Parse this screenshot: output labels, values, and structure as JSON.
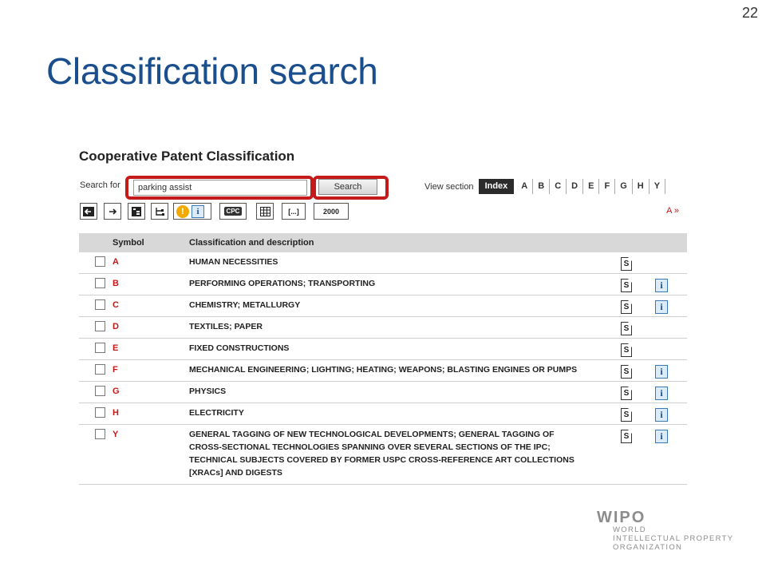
{
  "slide": {
    "page_number": "22",
    "title": "Classification search"
  },
  "app": {
    "title": "Cooperative Patent Classification",
    "search": {
      "label": "Search for",
      "value": "parking assist",
      "button_label": "Search"
    },
    "view_section": {
      "label": "View section",
      "index_label": "Index",
      "sections": [
        "A",
        "B",
        "C",
        "D",
        "E",
        "F",
        "G",
        "H",
        "Y"
      ]
    },
    "toolbar": {
      "cpc_label": "CPC",
      "bracket_label": "[...]",
      "year_label": "2000",
      "a_link": "A »"
    },
    "table": {
      "columns": [
        "Symbol",
        "Classification and description"
      ],
      "rows": [
        {
          "symbol": "A",
          "lines": [
            "HUMAN NECESSITIES"
          ],
          "has_s": true,
          "has_i": false
        },
        {
          "symbol": "B",
          "lines": [
            "PERFORMING OPERATIONS; TRANSPORTING"
          ],
          "has_s": true,
          "has_i": true
        },
        {
          "symbol": "C",
          "lines": [
            "CHEMISTRY; METALLURGY"
          ],
          "has_s": true,
          "has_i": true
        },
        {
          "symbol": "D",
          "lines": [
            "TEXTILES; PAPER"
          ],
          "has_s": true,
          "has_i": false
        },
        {
          "symbol": "E",
          "lines": [
            "FIXED CONSTRUCTIONS"
          ],
          "has_s": true,
          "has_i": false
        },
        {
          "symbol": "F",
          "lines": [
            "MECHANICAL ENGINEERING; LIGHTING; HEATING; WEAPONS; BLASTING ENGINES OR PUMPS"
          ],
          "has_s": true,
          "has_i": true
        },
        {
          "symbol": "G",
          "lines": [
            "PHYSICS"
          ],
          "has_s": true,
          "has_i": true
        },
        {
          "symbol": "H",
          "lines": [
            "ELECTRICITY"
          ],
          "has_s": true,
          "has_i": true
        },
        {
          "symbol": "Y",
          "lines": [
            "GENERAL TAGGING OF NEW TECHNOLOGICAL DEVELOPMENTS; GENERAL TAGGING OF",
            "CROSS-SECTIONAL TECHNOLOGIES SPANNING OVER SEVERAL SECTIONS OF THE IPC;",
            "TECHNICAL SUBJECTS COVERED BY FORMER USPC CROSS-REFERENCE ART COLLECTIONS",
            "[XRACs] AND DIGESTS"
          ],
          "has_s": true,
          "has_i": true
        }
      ],
      "s_icon_text": "S",
      "i_icon_text": "i"
    }
  },
  "logo": {
    "name": "WIPO",
    "lines": [
      "WORLD",
      "INTELLECTUAL PROPERTY",
      "ORGANIZATION"
    ]
  },
  "colors": {
    "title_blue": "#1a4e8c",
    "highlight_red": "#c41a1a",
    "symbol_red": "#c41a1a",
    "header_grey": "#d8d8d8"
  }
}
